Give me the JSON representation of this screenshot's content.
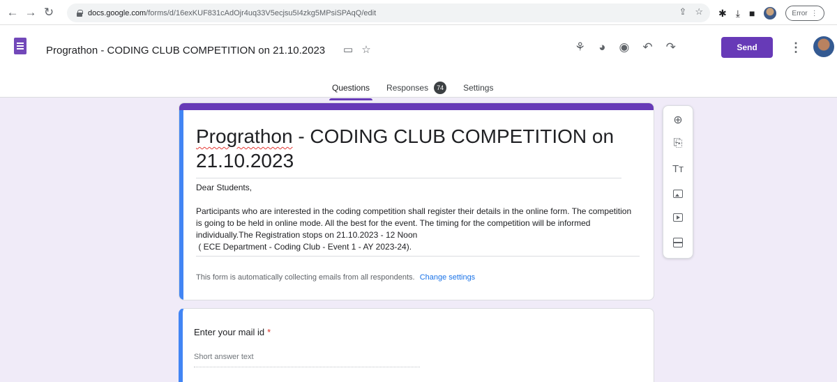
{
  "browser": {
    "back_icon": "arrow-left-icon",
    "forward_icon": "arrow-right-icon",
    "reload_icon": "reload-icon",
    "url_host": "docs.google.com",
    "url_path": "/forms/d/16exKUF831cAdOjr4uq33V5ecjsu5I4zkg5MPsiSPAqQ/edit",
    "error_label": "Error"
  },
  "header": {
    "title": "Prograthon - CODING CLUB COMPETITION on 21.10.2023",
    "send_label": "Send",
    "accent_color": "#673ab7",
    "tabs": [
      {
        "label": "Questions"
      },
      {
        "label": "Responses",
        "badge": "74"
      },
      {
        "label": "Settings"
      }
    ]
  },
  "form": {
    "title_prefix": "Prograthon",
    "title_rest": " - CODING CLUB COMPETITION on 21.10.2023",
    "description": "Dear Students,\n\nParticipants who are interested in the coding competition shall register their details in the online form. The competition is going to be held in online mode. All the best for the event. The timing for the competition will be informed individually.The Registration stops on 21.10.2023 - 12 Noon\n ( ECE Department - Coding Club - Event 1 - AY 2023-24).",
    "email_notice": "This form is automatically collecting emails from all respondents.",
    "change_settings_label": "Change settings",
    "questions": [
      {
        "label": "Enter your mail id",
        "required_mark": "*",
        "placeholder": "Short answer text"
      }
    ]
  },
  "side_toolbar": {
    "tools": [
      "add-question-icon",
      "import-questions-icon",
      "add-title-icon",
      "add-image-icon",
      "add-video-icon",
      "add-section-icon"
    ]
  }
}
